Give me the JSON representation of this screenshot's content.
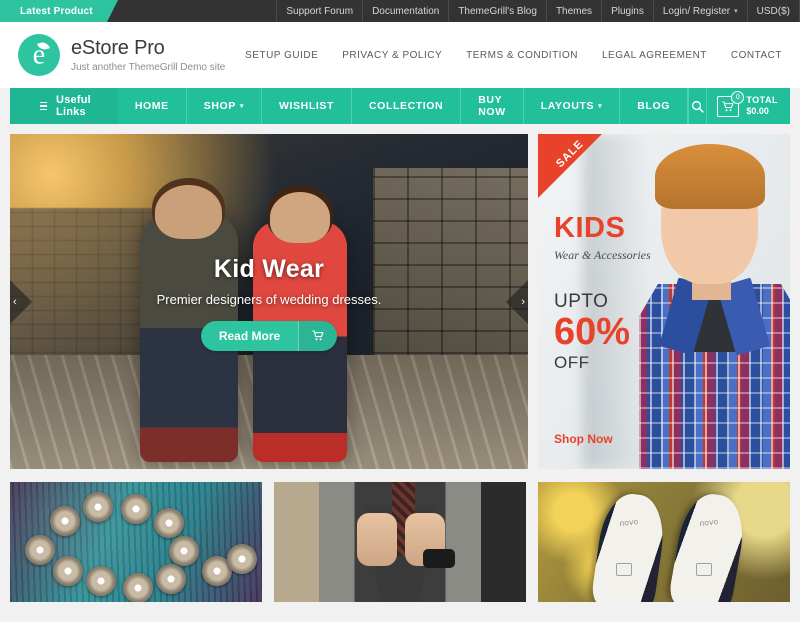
{
  "topbar": {
    "latest_label": "Latest Product",
    "links": [
      {
        "label": "Support Forum",
        "caret": false
      },
      {
        "label": "Documentation",
        "caret": false
      },
      {
        "label": "ThemeGrill's Blog",
        "caret": false
      },
      {
        "label": "Themes",
        "caret": false
      },
      {
        "label": "Plugins",
        "caret": false
      },
      {
        "label": "Login/ Register",
        "caret": true
      },
      {
        "label": "USD($)",
        "caret": false
      }
    ],
    "caret_glyph": "▾",
    "bg_color": "#333333"
  },
  "header": {
    "logo_letter": "e",
    "site_title": "eStore Pro",
    "site_tagline": "Just another ThemeGrill Demo site",
    "nav": [
      "SETUP GUIDE",
      "PRIVACY & POLICY",
      "TERMS & CONDITION",
      "LEGAL AGREEMENT",
      "CONTACT"
    ]
  },
  "mainnav": {
    "useful_links_label": "Useful Links",
    "items": [
      {
        "label": "HOME",
        "caret": false
      },
      {
        "label": "SHOP",
        "caret": true
      },
      {
        "label": "WISHLIST",
        "caret": false
      },
      {
        "label": "COLLECTION",
        "caret": false
      },
      {
        "label": "BUY NOW",
        "caret": false
      },
      {
        "label": "LAYOUTS",
        "caret": true
      },
      {
        "label": "BLOG",
        "caret": false
      }
    ],
    "caret_glyph": "▾",
    "search_glyph": "⌕",
    "cart": {
      "icon_glyph": "Ὥ2",
      "badge_count": "0",
      "total_label": "TOTAL",
      "total_amount": "$0.00"
    },
    "accent_color": "#21bf9a"
  },
  "slider": {
    "title": "Kid Wear",
    "subtitle": "Premier designers of wedding dresses.",
    "button_label": "Read More",
    "button_icon_glyph": "Ὥ2",
    "prev_glyph": "‹",
    "next_glyph": "›"
  },
  "promo": {
    "ribbon_label": "SALE",
    "headline": "KIDS",
    "subhead": "Wear & Accessories",
    "upto_label": "UPTO",
    "percent": "60%",
    "off_label": "OFF",
    "cta_label": "Shop Now",
    "accent_color": "#e8432a"
  },
  "products": [
    {
      "name": "jewelry-flowers-thumb"
    },
    {
      "name": "man-tie-thumb"
    },
    {
      "name": "novo-shoes-thumb",
      "brand_text": "novo"
    }
  ]
}
